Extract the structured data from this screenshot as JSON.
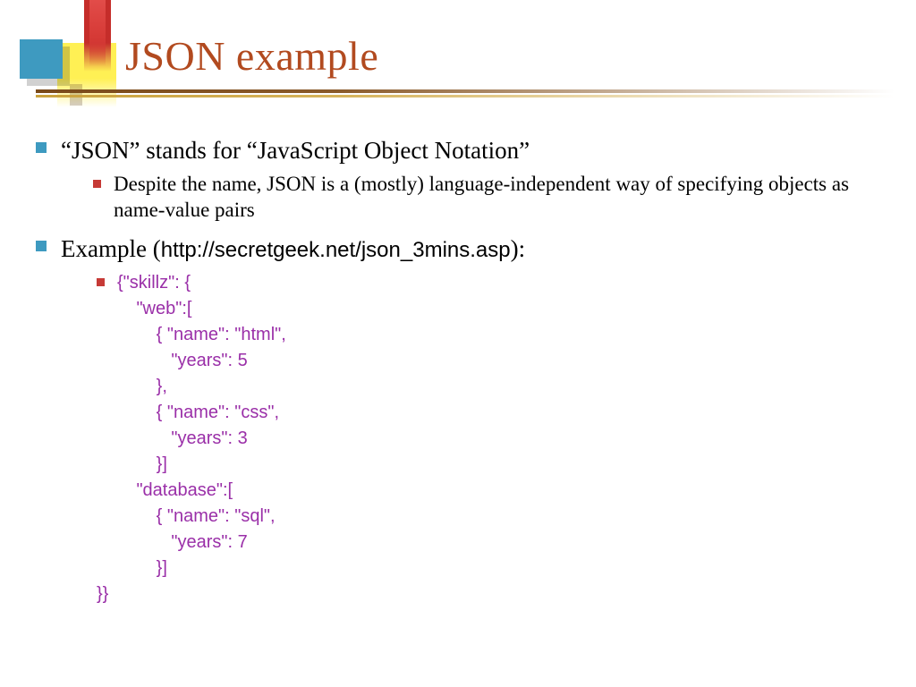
{
  "title": "JSON example",
  "bullets": {
    "b1": "“JSON” stands for “JavaScript Object Notation”",
    "b1_sub": "Despite the name, JSON is a (mostly) language-independent way of specifying objects as name-value pairs",
    "b2_prefix": "Example (",
    "b2_url": "http://secretgeek.net/json_3mins.asp",
    "b2_suffix": "):"
  },
  "code": {
    "l1": "{\"skillz\": {",
    "l2": "        \"web\":[",
    "l3": "            { \"name\": \"html\", ",
    "l4": "               \"years\": 5 ",
    "l5": "            },",
    "l6": "            { \"name\": \"css\", ",
    "l7": "               \"years\": 3 ",
    "l8": "            }]",
    "l9": "        \"database\":[",
    "l10": "            { \"name\": \"sql\", ",
    "l11": "               \"years\": 7 ",
    "l12": "            }]",
    "l13": "}}"
  }
}
